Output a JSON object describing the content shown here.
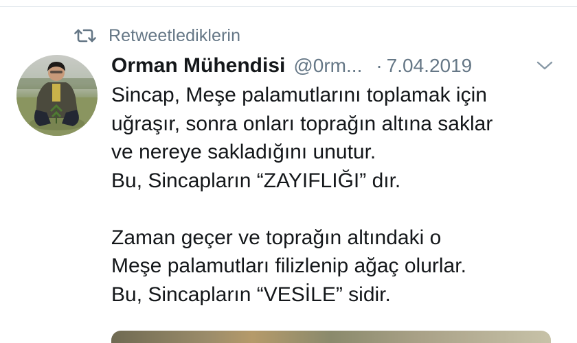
{
  "retweet": {
    "label": "Retweetlediklerin",
    "icon": "retweet-icon"
  },
  "tweet": {
    "author": {
      "display_name": "Orman Mühendisi",
      "handle": "@0rm...",
      "avatar": "avatar"
    },
    "separator": "·",
    "date": "7.04.2019",
    "menu_icon": "chevron-down-icon",
    "text_lines": [
      "Sincap, Meşe palamutlarını toplamak için",
      "uğraşır, sonra onları toprağın altına saklar",
      "ve nereye sakladığını unutur.",
      "Bu, Sincapların “ZAYIFLIĞI” dır.",
      "",
      "Zaman geçer ve toprağın altındaki o",
      "Meşe palamutları filizlenip ağaç olurlar.",
      "Bu, Sincapların “VESİLE” sidir."
    ],
    "media": "tweet-image"
  },
  "colors": {
    "text_primary": "#14171a",
    "text_secondary": "#657786",
    "divider": "#e6ecf0",
    "background": "#ffffff"
  }
}
